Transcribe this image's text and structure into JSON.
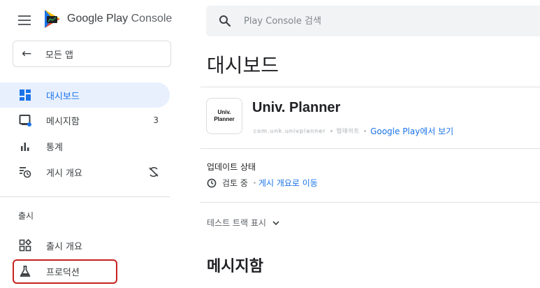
{
  "header": {
    "brand": "Google Play",
    "brand_suffix": " Console",
    "search_placeholder": "Play Console 검색"
  },
  "sidebar": {
    "all_apps_label": "모든 앱",
    "items": [
      {
        "label": "대시보드",
        "active": true
      },
      {
        "label": "메시지함",
        "badge": "3"
      },
      {
        "label": "통계"
      },
      {
        "label": "게시 개요"
      }
    ],
    "section_title": "출시",
    "release_items": [
      {
        "label": "출시 개요"
      },
      {
        "label": "프로덕션",
        "highlighted": true
      }
    ]
  },
  "main": {
    "title": "대시보드",
    "app": {
      "icon_line1": "Univ.",
      "icon_line2": "Planner",
      "name": "Univ. Planner",
      "meta_blurred_1": "com.unk.univplanner",
      "meta_blurred_2": "업데이트",
      "view_on_play": "Google Play에서 보기"
    },
    "update_status": {
      "label": "업데이트 상태",
      "status": "검토 중",
      "link": "게시 개요로 이동"
    },
    "test_track_label": "테스트 트랙 표시",
    "inbox_heading": "메시지함"
  },
  "colors": {
    "accent": "#1a73e8",
    "active_bg": "#e8f0fe",
    "highlight_border": "#c5221f"
  }
}
